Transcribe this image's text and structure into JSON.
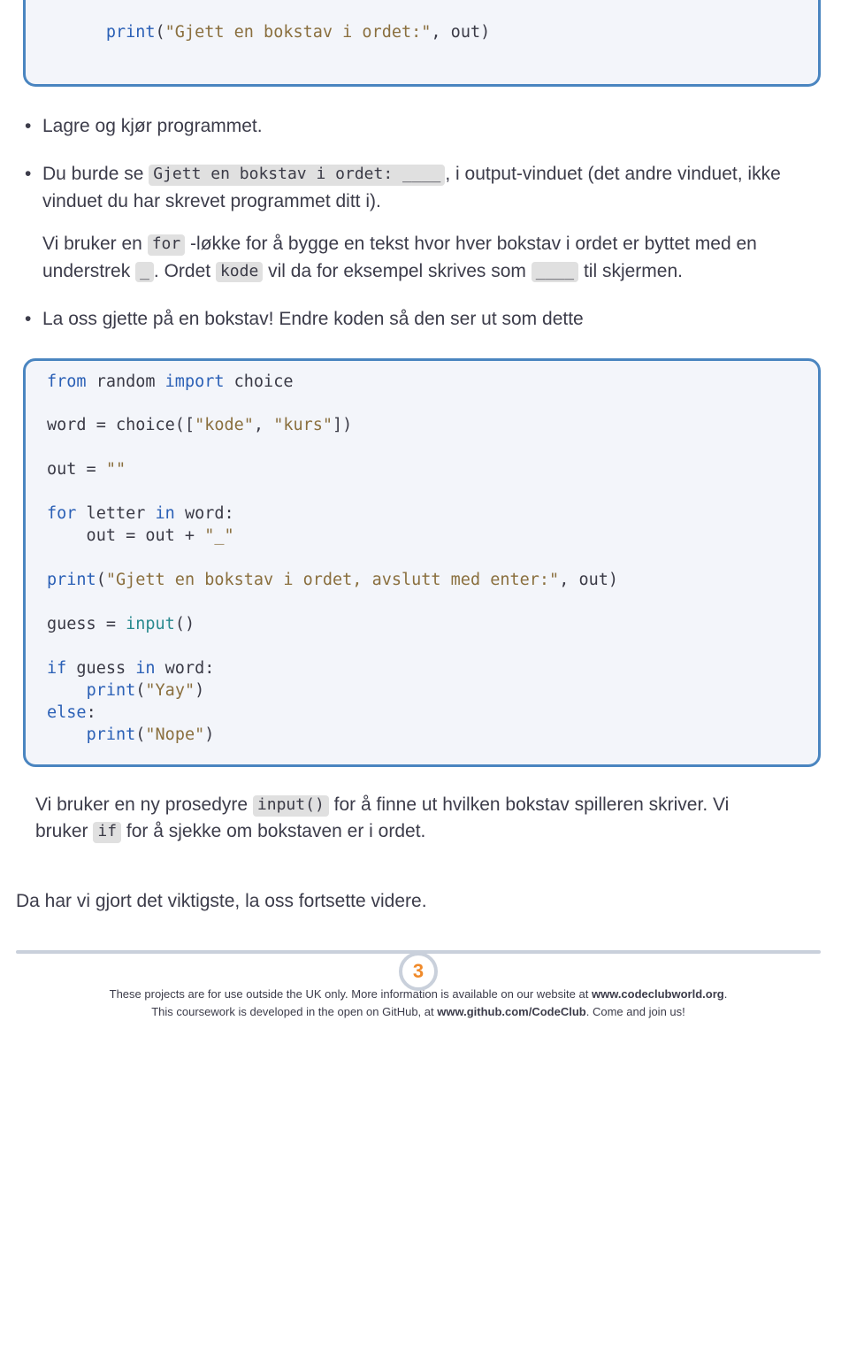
{
  "code1": {
    "l1a": "print",
    "l1b": "(",
    "l1c": "\"Gjett en bokstav i ordet:\"",
    "l1d": ", out)"
  },
  "bullets": {
    "b1": "Lagre og kjør programmet.",
    "b2_a": "Du burde se ",
    "b2_chip": "Gjett en bokstav i ordet: ____",
    "b2_b": ", i output-vinduet (det andre vinduet, ikke vinduet du har skrevet programmet ditt i).",
    "b3_a": "Vi bruker en ",
    "b3_for": "for",
    "b3_b": " -løkke for å bygge en tekst hvor hver bokstav i ordet er byttet med en understrek ",
    "b3_us": "_",
    "b3_c": ". Ordet ",
    "b3_kode": "kode",
    "b3_d": " vil da for eksempel skrives som ",
    "b3_blk": "____",
    "b3_e": " til skjermen.",
    "b4": "La oss gjette på en bokstav! Endre koden så den ser ut som dette"
  },
  "code2": {
    "l1a": "from",
    "l1b": " random ",
    "l1c": "import",
    "l1d": " choice",
    "l3a": "word = choice([",
    "l3b": "\"kode\"",
    "l3c": ", ",
    "l3d": "\"kurs\"",
    "l3e": "])",
    "l5a": "out = ",
    "l5b": "\"\"",
    "l7a": "for",
    "l7b": " letter ",
    "l7c": "in",
    "l7d": " word:",
    "l8a": "    out = out + ",
    "l8b": "\"_\"",
    "l10a": "print",
    "l10b": "(",
    "l10c": "\"Gjett en bokstav i ordet, avslutt med enter:\"",
    "l10d": ", out)",
    "l12a": "guess = ",
    "l12b": "input",
    "l12c": "()",
    "l14a": "if",
    "l14b": " guess ",
    "l14c": "in",
    "l14d": " word:",
    "l15a": "    ",
    "l15b": "print",
    "l15c": "(",
    "l15d": "\"Yay\"",
    "l15e": ")",
    "l16a": "else",
    "l16b": ":",
    "l17a": "    ",
    "l17b": "print",
    "l17c": "(",
    "l17d": "\"Nope\"",
    "l17e": ")"
  },
  "para2": {
    "a": "Vi bruker en ny prosedyre ",
    "chip1": "input()",
    "b": " for å finne ut hvilken bokstav spilleren skriver. Vi bruker ",
    "chip2": "if",
    "c": " for å sjekke om bokstaven er i ordet."
  },
  "closing": "Da har vi gjort det viktigste, la oss fortsette videre.",
  "page_number": "3",
  "footer": {
    "l1a": "These projects are for use outside the UK only. More information is available on our website at ",
    "l1b": "www.codeclubworld.org",
    "l1c": ".",
    "l2a": "This coursework is developed in the open on GitHub, at ",
    "l2b": "www.github.com/CodeClub",
    "l2c": ". Come and join us!"
  }
}
